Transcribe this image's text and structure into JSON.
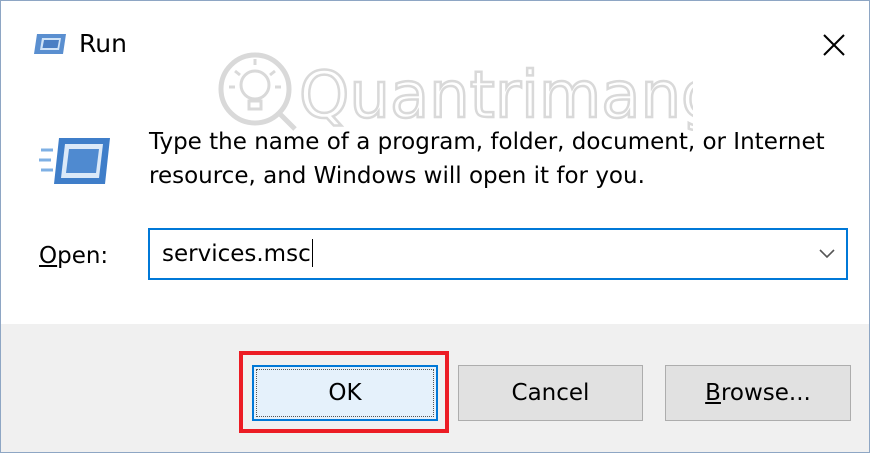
{
  "window": {
    "title": "Run",
    "icon": "run-icon",
    "close_icon": "close-icon"
  },
  "watermark": {
    "text": "Quantrimang"
  },
  "body": {
    "description": "Type the name of a program, folder, document, or Internet resource, and Windows will open it for you.",
    "open_label_mnemonic": "O",
    "open_label_rest": "pen:",
    "open_value": "services.msc",
    "dropdown_icon": "chevron-down-icon"
  },
  "buttons": {
    "ok": "OK",
    "cancel": "Cancel",
    "browse_mnemonic": "B",
    "browse_rest": "rowse..."
  },
  "colors": {
    "accent": "#0078d7",
    "highlight": "#ec1c24",
    "footer_bg": "#f0f0f0",
    "button_bg": "#e1e1e1"
  }
}
